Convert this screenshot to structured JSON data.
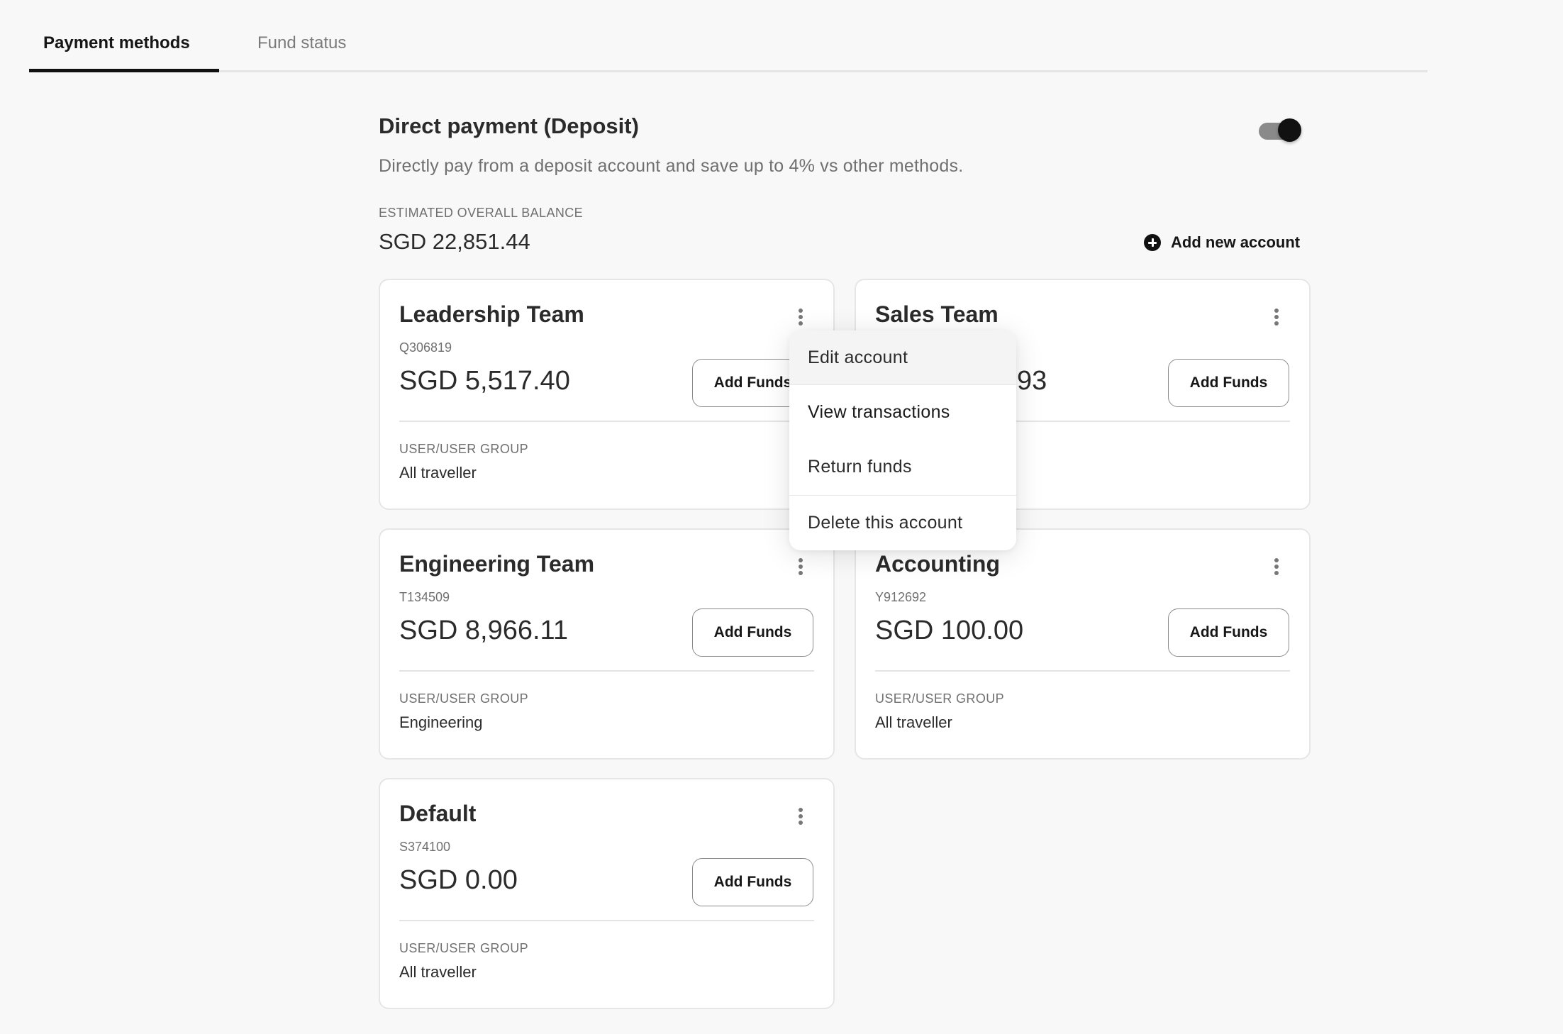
{
  "tabs": [
    {
      "label": "Payment methods",
      "active": true
    },
    {
      "label": "Fund status",
      "active": false
    }
  ],
  "section": {
    "title": "Direct payment (Deposit)",
    "enabled": true,
    "description": "Directly pay from a deposit account and save up to 4% vs other methods.",
    "balance_label": "ESTIMATED OVERALL BALANCE",
    "balance_value": "SGD 22,851.44",
    "add_account_label": "Add new account",
    "add_account_icon": "plus-circle-icon"
  },
  "accounts": [
    {
      "name": "Leadership Team",
      "id": "Q306819",
      "amount": "SGD 5,517.40",
      "button": "Add Funds",
      "group_label": "USER/USER GROUP",
      "group": "All traveller"
    },
    {
      "name": "Sales Team",
      "id": "",
      "amount": "93",
      "button": "Add Funds",
      "group_label": "",
      "group": ""
    },
    {
      "name": "Engineering Team",
      "id": "T134509",
      "amount": "SGD 8,966.11",
      "button": "Add Funds",
      "group_label": "USER/USER GROUP",
      "group": "Engineering"
    },
    {
      "name": "Accounting",
      "id": "Y912692",
      "amount": "SGD 100.00",
      "button": "Add Funds",
      "group_label": "USER/USER GROUP",
      "group": "All traveller"
    },
    {
      "name": "Default",
      "id": "S374100",
      "amount": "SGD 0.00",
      "button": "Add Funds",
      "group_label": "USER/USER GROUP",
      "group": "All traveller"
    }
  ],
  "menu": {
    "items": [
      {
        "label": "Edit account",
        "hovered": true
      },
      {
        "label": "View transactions"
      },
      {
        "label": "Return funds"
      },
      {
        "label": "Delete this account"
      }
    ]
  },
  "colors": {
    "background": "#f8f8f8",
    "card": "#ffffff",
    "text_primary": "#2b2b2b",
    "text_secondary": "#707070",
    "accent": "#111111",
    "toggle_track": "#8a8a8a"
  }
}
